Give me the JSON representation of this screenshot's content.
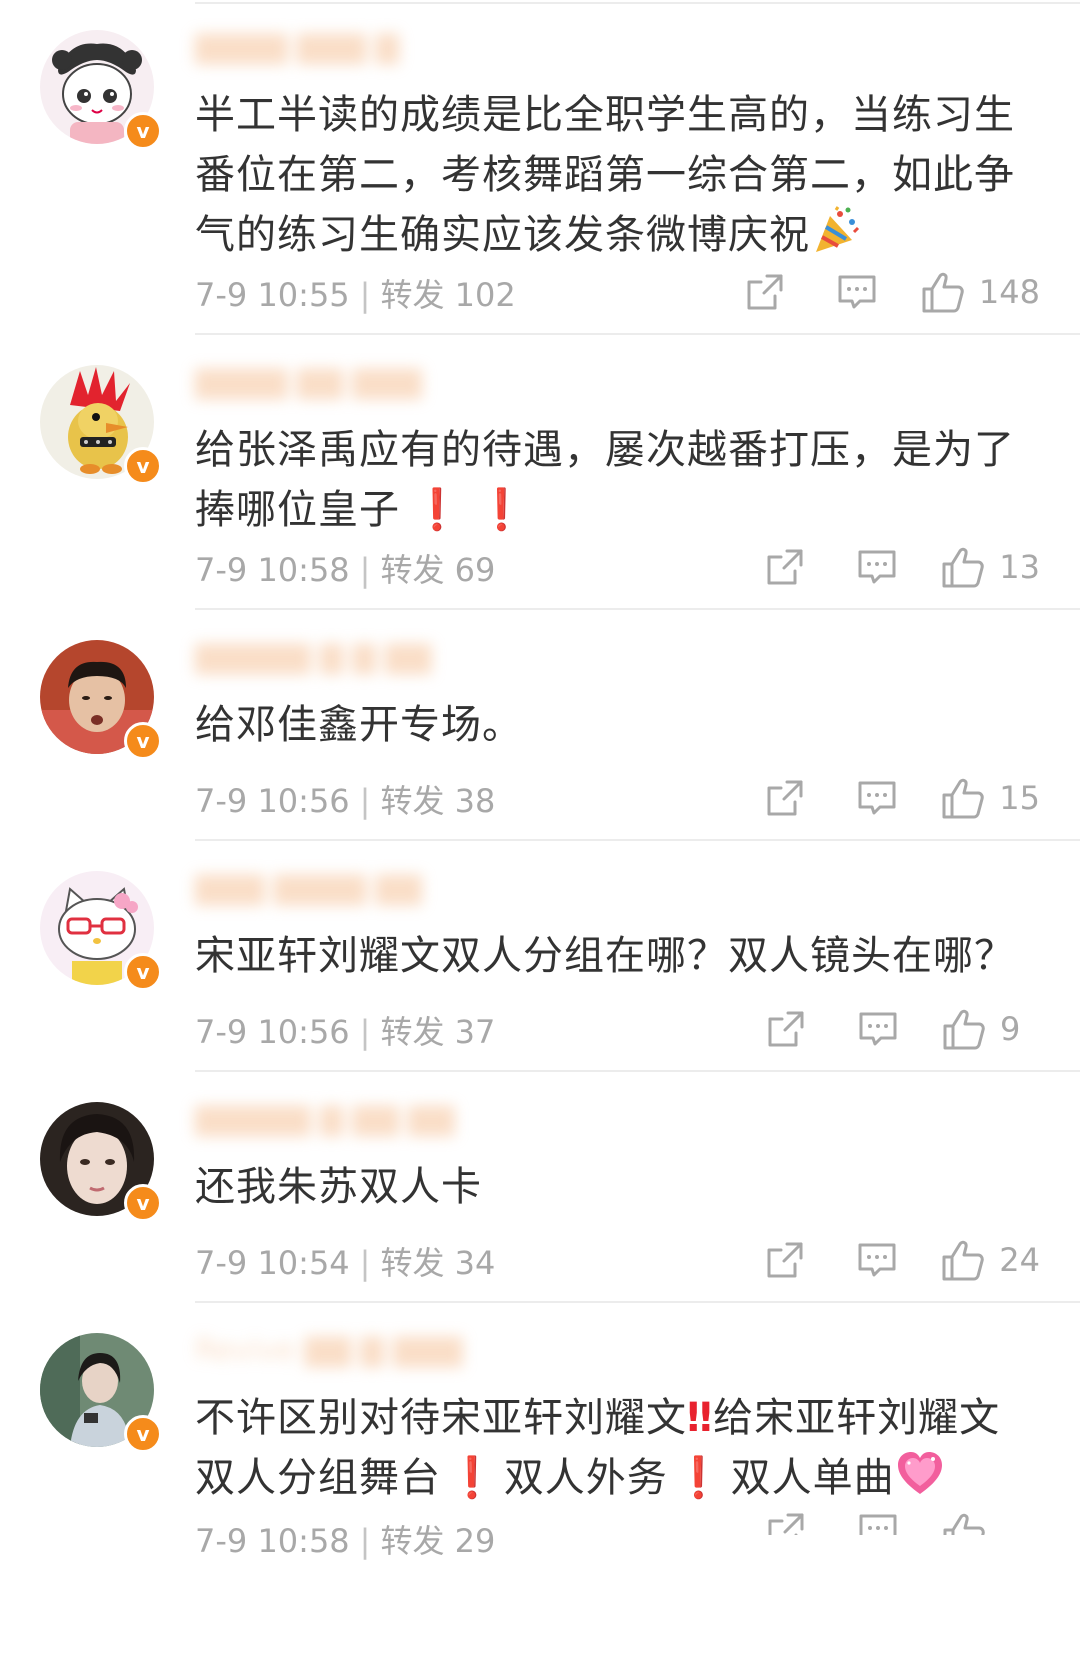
{
  "colors": {
    "verified_badge": "#f58b1b",
    "exclamation": "#e8222e",
    "meta_text": "#a8a8a8",
    "comment_text": "#333333",
    "divider": "#ececec"
  },
  "icons": {
    "share": "share-icon",
    "reply": "comment-icon",
    "like": "thumbs-up-icon",
    "verified": "verified-v-badge"
  },
  "comments": [
    {
      "text_parts": [
        "半工半读的成绩是比全职学生高的，当练习生番位在第二，考核舞蹈第一综合第二，如此争气的练习生确实应该发条微博庆祝"
      ],
      "emoji": "party-popper",
      "time": "7-9 10:55",
      "repost_label": "转发",
      "repost_count": "102",
      "like_count": "148",
      "verified": "v"
    },
    {
      "text_parts": [
        "给张泽禹应有的待遇，屡次越番打压，是为了捧哪位皇子",
        "❗",
        "❗"
      ],
      "time": "7-9 10:58",
      "repost_label": "转发",
      "repost_count": "69",
      "like_count": "13",
      "verified": "v"
    },
    {
      "text_parts": [
        "给邓佳鑫开专场。"
      ],
      "time": "7-9 10:56",
      "repost_label": "转发",
      "repost_count": "38",
      "like_count": "15",
      "verified": "v"
    },
    {
      "text_parts": [
        "宋亚轩刘耀文双人分组在哪？双人镜头在哪？"
      ],
      "time": "7-9 10:56",
      "repost_label": "转发",
      "repost_count": "37",
      "like_count": "9",
      "verified": "v"
    },
    {
      "text_parts": [
        "还我朱苏双人卡"
      ],
      "time": "7-9 10:54",
      "repost_label": "转发",
      "repost_count": "34",
      "like_count": "24",
      "verified": "v"
    },
    {
      "text_parts": [
        "不许区别对待宋亚轩刘耀文",
        "‼",
        "给宋亚轩刘耀文双人分组舞台",
        "❗",
        "双人外务",
        "❗",
        "双人单曲"
      ],
      "emoji": "sparkling-heart",
      "time": "7-9 10:58",
      "repost_label": "转发",
      "repost_count": "29",
      "verified": "v"
    }
  ]
}
